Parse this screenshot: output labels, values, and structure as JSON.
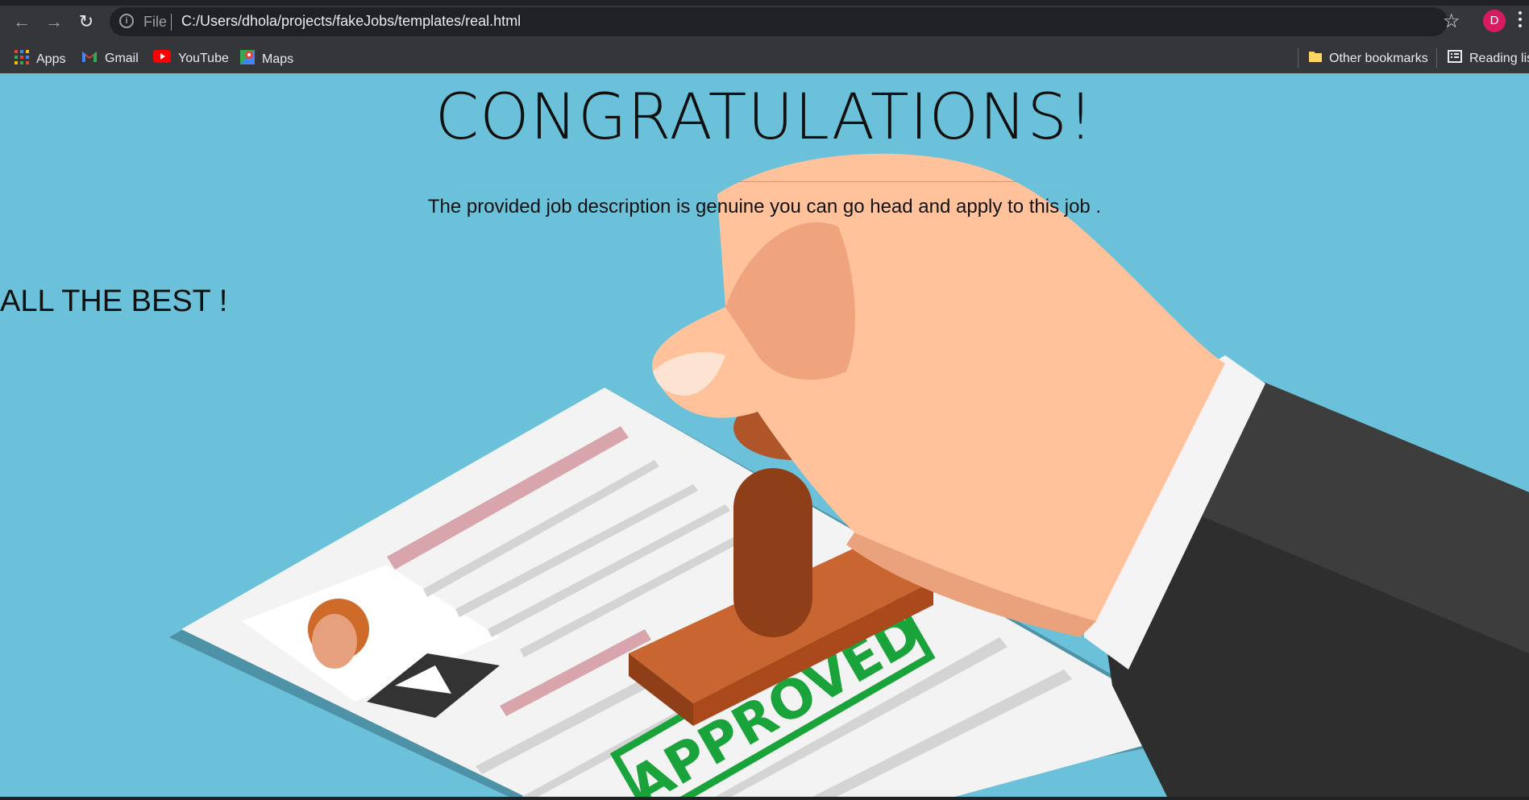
{
  "browser": {
    "nav": {
      "back_icon": "arrow-left-icon",
      "forward_icon": "arrow-right-icon",
      "reload_icon": "reload-icon"
    },
    "omnibox": {
      "scheme_label": "File",
      "url": "C:/Users/dhola/projects/fakeJobs/templates/real.html"
    },
    "profile_initial": "D",
    "colors": {
      "toolbar": "#35363a",
      "omnibox": "#202124",
      "avatar": "#d81b60"
    }
  },
  "bookmarks": {
    "items": [
      {
        "label": "Apps",
        "icon": "apps-grid-icon"
      },
      {
        "label": "Gmail",
        "icon": "gmail-icon"
      },
      {
        "label": "YouTube",
        "icon": "youtube-icon"
      },
      {
        "label": "Maps",
        "icon": "maps-icon"
      }
    ],
    "other_bookmarks": "Other bookmarks",
    "reading_list": "Reading lis"
  },
  "page": {
    "heading": "CONGRATULATIONS!",
    "description": "The provided job description is genuine you can go head and apply to this job .",
    "best_wishes": "ALL THE BEST !",
    "background_color": "#6cc1da",
    "illustration": {
      "stamp_text": "APPROVED",
      "stamp_color": "#1aa33a"
    }
  }
}
